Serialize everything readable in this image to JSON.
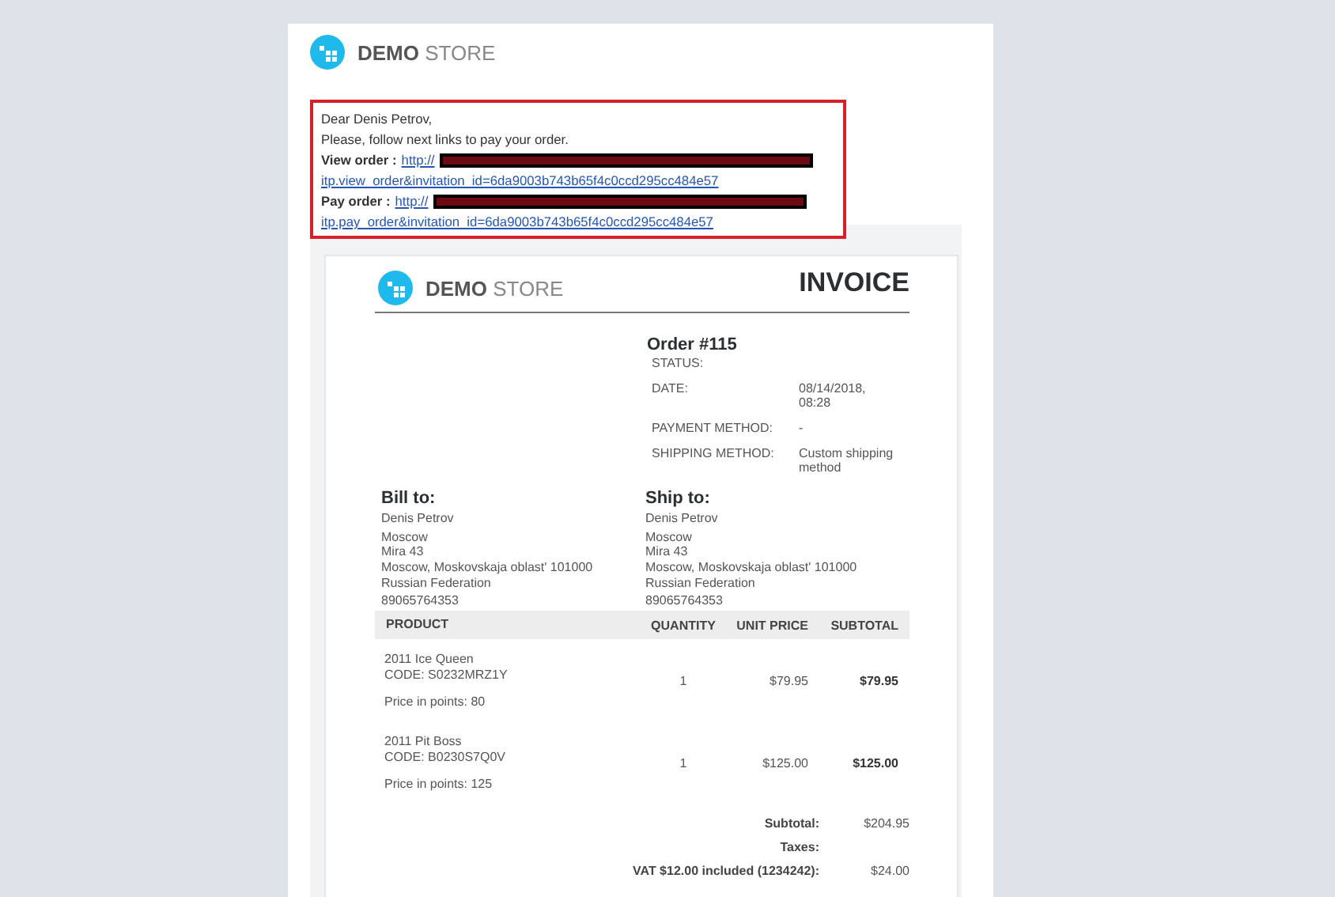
{
  "store": {
    "brand_bold": "DEMO",
    "brand_light": "STORE"
  },
  "message": {
    "greeting": "Dear Denis Petrov,",
    "intro": "Please, follow next links to pay your order.",
    "links": [
      {
        "label": "View order :",
        "url_start": "http://",
        "url_end": "itp.view_order&invitation_id=6da9003b743b65f4c0ccd295cc484e57",
        "redacted": true
      },
      {
        "label": "Pay order :",
        "url_start": "http://",
        "url_end": "itp.pay_order&invitation_id=6da9003b743b65f4c0ccd295cc484e57",
        "redacted": true
      }
    ]
  },
  "invoice": {
    "brand_bold": "DEMO",
    "brand_light": "STORE",
    "title": "INVOICE",
    "order": "Order #115",
    "details": [
      {
        "label": "STATUS:"
      },
      {
        "label": "DATE:",
        "value": "08/14/2018, 08:28"
      },
      {
        "label": "PAYMENT METHOD:",
        "value": "-"
      },
      {
        "label": "SHIPPING METHOD:",
        "value": "Custom shipping method"
      }
    ],
    "addresses": [
      {
        "heading": "Bill to:",
        "name": "Denis Petrov",
        "lines": [
          "Moscow",
          "Mira 43"
        ],
        "region": "Moscow, Moskovskaja oblast' 101000",
        "country": "Russian Federation",
        "phone": "89065764353"
      },
      {
        "heading": "Ship to:",
        "name": "Denis Petrov",
        "lines": [
          "Moscow",
          "Mira 43"
        ],
        "region": "Moscow, Moskovskaja oblast' 101000",
        "country": "Russian Federation",
        "phone": "89065764353"
      }
    ],
    "table": {
      "columns": [
        "PRODUCT",
        "QUANTITY",
        "UNIT PRICE",
        "SUBTOTAL"
      ],
      "rows": [
        {
          "name": "2011 Ice Queen",
          "code": "CODE: S0232MRZ1Y",
          "points": "Price in points: 80",
          "quantity": "1",
          "unit_price": "$79.95",
          "subtotal": "$79.95"
        },
        {
          "name": "2011 Pit Boss",
          "code": "CODE: B0230S7Q0V",
          "points": "Price in points: 125",
          "quantity": "1",
          "unit_price": "$125.00",
          "subtotal": "$125.00"
        }
      ]
    },
    "totals": [
      {
        "label": "Subtotal:",
        "value": "$204.95"
      },
      {
        "label": "Taxes:"
      },
      {
        "label": "VAT $12.00 included (1234242):",
        "value": "$24.00"
      }
    ]
  }
}
